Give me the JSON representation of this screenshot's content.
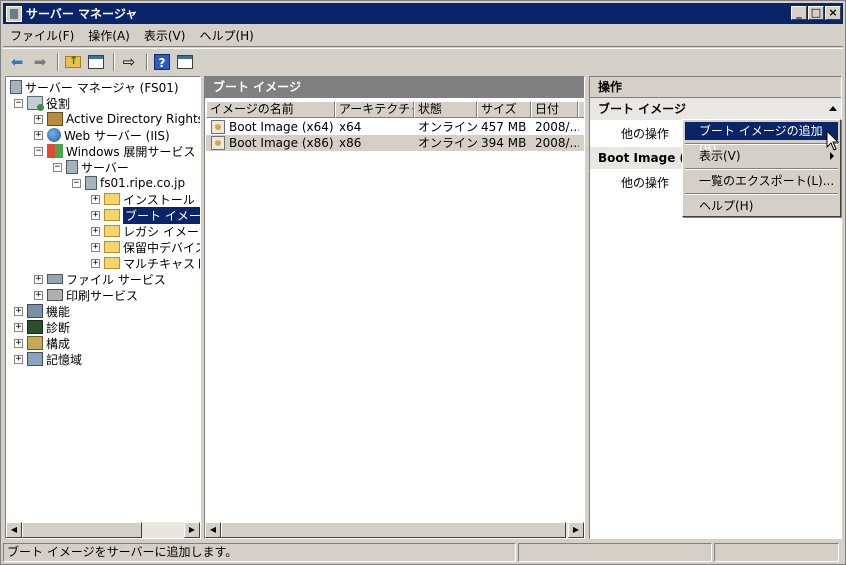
{
  "window": {
    "title": "サーバー マネージャ",
    "min_glyph": "_",
    "max_glyph": "□",
    "close_glyph": "×"
  },
  "menu": [
    "ファイル(F)",
    "操作(A)",
    "表示(V)",
    "ヘルプ(H)"
  ],
  "toolbar": {
    "icons": [
      "back-arrow-icon",
      "forward-arrow-icon",
      "folder-up-icon",
      "show-hide-tree-icon",
      "export-list-icon",
      "help-icon",
      "show-hide-action-pane-icon"
    ],
    "back_glyph": "⬅",
    "forward_glyph": "➡",
    "export_glyph": "⇨",
    "help_glyph": "?"
  },
  "tree": {
    "root": "サーバー マネージャ (FS01)",
    "roles": "役割",
    "ad": "Active Directory Rights Ma",
    "web": "Web サーバー (IIS)",
    "wds": "Windows 展開サービス",
    "servers": "サーバー",
    "host": "fs01.ripe.co.jp",
    "install": "インストール イメ",
    "boot": "ブート イメージ",
    "legacy": "レガシ イメージ",
    "pending": "保留中デバイス",
    "multicast": "マルチキャスト転",
    "file": "ファイル サービス",
    "print": "印刷サービス",
    "features": "機能",
    "diagnostics": "診断",
    "config": "構成",
    "storage": "記憶域",
    "expand_glyph": "+",
    "collapse_glyph": "−"
  },
  "scroll": {
    "left_glyph": "◀",
    "right_glyph": "▶"
  },
  "middle": {
    "header": "ブート イメージ",
    "columns": [
      "イメージの名前",
      "アーキテクチャ",
      "状態",
      "サイズ",
      "日付"
    ],
    "rows": [
      {
        "name": "Boot Image (x64)",
        "arch": "x64",
        "status": "オンライン",
        "size": "457 MB",
        "date": "2008/..."
      },
      {
        "name": "Boot Image (x86)",
        "arch": "x86",
        "status": "オンライン",
        "size": "394 MB",
        "date": "2008/..."
      }
    ]
  },
  "actions": {
    "header": "操作",
    "section1": "ブート イメージ",
    "section1_item": "他の操作",
    "section2": "Boot Image (x",
    "section2_item": "他の操作"
  },
  "context_menu": {
    "items": [
      "ブート イメージの追加(B)",
      "表示(V)",
      "一覧のエクスポート(L)...",
      "ヘルプ(H)"
    ],
    "highlighted_index": 0
  },
  "status": {
    "text": "ブート イメージをサーバーに追加します。",
    "panel2": "",
    "panel3": ""
  },
  "colors": {
    "title_bar": "#0a246a",
    "face": "#d4d0c8",
    "selection": "#0a246a",
    "pane_header": "#808080"
  }
}
